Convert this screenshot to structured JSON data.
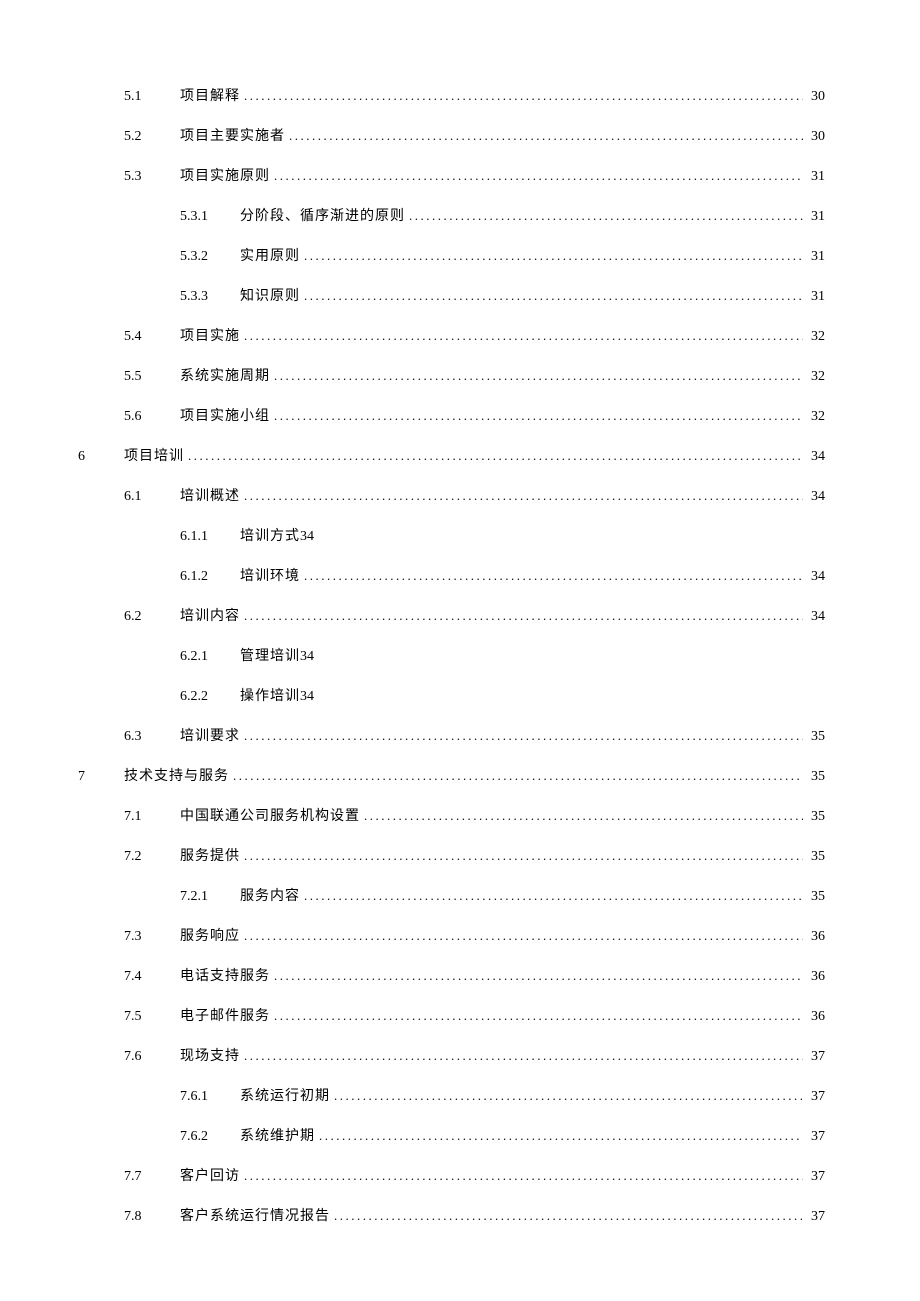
{
  "toc": [
    {
      "level": 2,
      "number": "5.1",
      "title": "项目解释",
      "page": "30",
      "noDots": false
    },
    {
      "level": 2,
      "number": "5.2",
      "title": "项目主要实施者",
      "page": "30",
      "noDots": false
    },
    {
      "level": 2,
      "number": "5.3",
      "title": "项目实施原则",
      "page": "31",
      "noDots": false
    },
    {
      "level": 3,
      "number": "5.3.1",
      "title": "分阶段、循序渐进的原则",
      "page": "31",
      "noDots": false
    },
    {
      "level": 3,
      "number": "5.3.2",
      "title": "实用原则",
      "page": "31",
      "noDots": false
    },
    {
      "level": 3,
      "number": "5.3.3",
      "title": "知识原则",
      "page": "31",
      "noDots": false
    },
    {
      "level": 2,
      "number": "5.4",
      "title": "项目实施",
      "page": "32",
      "noDots": false
    },
    {
      "level": 2,
      "number": "5.5",
      "title": "系统实施周期",
      "page": "32",
      "noDots": false
    },
    {
      "level": 2,
      "number": "5.6",
      "title": "项目实施小组",
      "page": "32",
      "noDots": false
    },
    {
      "level": 1,
      "number": "6",
      "title": "项目培训",
      "page": "34",
      "noDots": false
    },
    {
      "level": 2,
      "number": "6.1",
      "title": "培训概述",
      "page": "34",
      "noDots": false
    },
    {
      "level": 3,
      "number": "6.1.1",
      "title": "培训方式",
      "page": "34",
      "noDots": true
    },
    {
      "level": 3,
      "number": "6.1.2",
      "title": "培训环境",
      "page": "34",
      "noDots": false
    },
    {
      "level": 2,
      "number": "6.2",
      "title": "培训内容",
      "page": "34",
      "noDots": false
    },
    {
      "level": 3,
      "number": "6.2.1",
      "title": "管理培训",
      "page": "34",
      "noDots": true
    },
    {
      "level": 3,
      "number": "6.2.2",
      "title": "操作培训",
      "page": "34",
      "noDots": true
    },
    {
      "level": 2,
      "number": "6.3",
      "title": "培训要求",
      "page": "35",
      "noDots": false
    },
    {
      "level": 1,
      "number": "7",
      "title": "技术支持与服务",
      "page": "35",
      "noDots": false
    },
    {
      "level": 2,
      "number": "7.1",
      "title": "中国联通公司服务机构设置",
      "page": "35",
      "noDots": false
    },
    {
      "level": 2,
      "number": "7.2",
      "title": "服务提供",
      "page": "35",
      "noDots": false
    },
    {
      "level": 3,
      "number": "7.2.1",
      "title": "服务内容",
      "page": "35",
      "noDots": false
    },
    {
      "level": 2,
      "number": "7.3",
      "title": "服务响应",
      "page": "36",
      "noDots": false
    },
    {
      "level": 2,
      "number": "7.4",
      "title": "电话支持服务",
      "page": "36",
      "noDots": false
    },
    {
      "level": 2,
      "number": "7.5",
      "title": "电子邮件服务",
      "page": "36",
      "noDots": false
    },
    {
      "level": 2,
      "number": "7.6",
      "title": "现场支持",
      "page": "37",
      "noDots": false
    },
    {
      "level": 3,
      "number": "7.6.1",
      "title": "系统运行初期",
      "page": "37",
      "noDots": false
    },
    {
      "level": 3,
      "number": "7.6.2",
      "title": "系统维护期",
      "page": "37",
      "noDots": false
    },
    {
      "level": 2,
      "number": "7.7",
      "title": "客户回访",
      "page": "37",
      "noDots": false
    },
    {
      "level": 2,
      "number": "7.8",
      "title": "客户系统运行情况报告",
      "page": "37",
      "noDots": false
    }
  ]
}
